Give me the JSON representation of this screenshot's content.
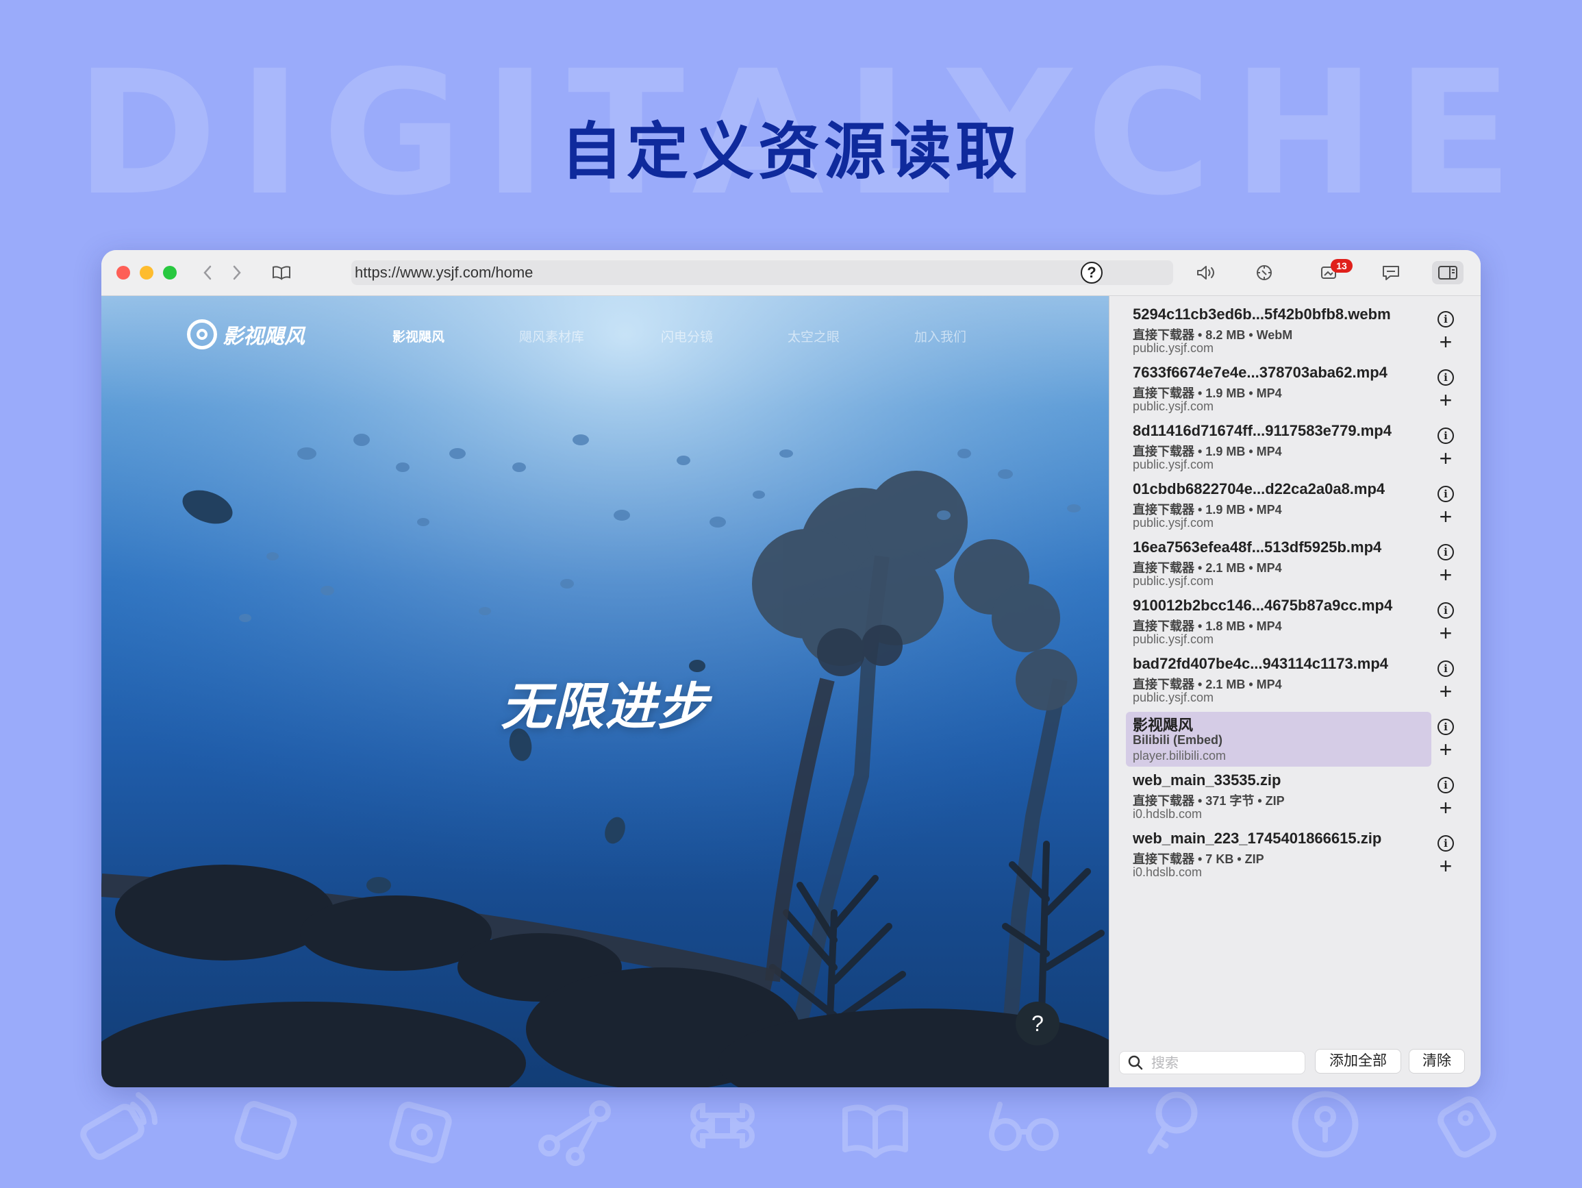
{
  "watermark": "DIGITALYCHEE",
  "headline": "自定义资源读取",
  "browser": {
    "url": "https://www.ysjf.com/home",
    "notification_count": "13"
  },
  "site": {
    "logo_text": "影视飓风",
    "nav": [
      "影视飓风",
      "飓风素材库",
      "闪电分镜",
      "太空之眼",
      "加入我们"
    ],
    "hero_text": "无限进步",
    "help_label": "?"
  },
  "resources": [
    {
      "title": "5294c11cb3ed6b...5f42b0bfb8.webm",
      "meta": "直接下载器 • 8.2 MB • WebM",
      "host": "public.ysjf.com"
    },
    {
      "title": "7633f6674e7e4e...378703aba62.mp4",
      "meta": "直接下载器 • 1.9 MB • MP4",
      "host": "public.ysjf.com"
    },
    {
      "title": "8d11416d71674ff...9117583e779.mp4",
      "meta": "直接下载器 • 1.9 MB • MP4",
      "host": "public.ysjf.com"
    },
    {
      "title": "01cbdb6822704e...d22ca2a0a8.mp4",
      "meta": "直接下载器 • 1.9 MB • MP4",
      "host": "public.ysjf.com"
    },
    {
      "title": "16ea7563efea48f...513df5925b.mp4",
      "meta": "直接下载器 • 2.1 MB • MP4",
      "host": "public.ysjf.com"
    },
    {
      "title": "910012b2bcc146...4675b87a9cc.mp4",
      "meta": "直接下载器 • 1.8 MB • MP4",
      "host": "public.ysjf.com"
    },
    {
      "title": "bad72fd407be4c...943114c1173.mp4",
      "meta": "直接下载器 • 2.1 MB • MP4",
      "host": "public.ysjf.com"
    },
    {
      "title": "影视飓风",
      "meta": "Bilibili (Embed)",
      "host": "player.bilibili.com",
      "selected": true
    },
    {
      "title": "web_main_33535.zip",
      "meta": "直接下载器 • 371 字节 • ZIP",
      "host": "i0.hdslb.com"
    },
    {
      "title": "web_main_223_1745401866615.zip",
      "meta": "直接下载器 • 7 KB • ZIP",
      "host": "i0.hdslb.com"
    }
  ],
  "item_icons": {
    "info": "info-icon",
    "add": "plus-icon"
  },
  "footer": {
    "search_placeholder": "搜索",
    "add_all_label": "添加全部",
    "clear_label": "清除"
  },
  "colors": {
    "background": "#9aabfa",
    "headline": "#0f2a9c",
    "selected_row": "#d5cce6",
    "badge": "#e0201b"
  }
}
